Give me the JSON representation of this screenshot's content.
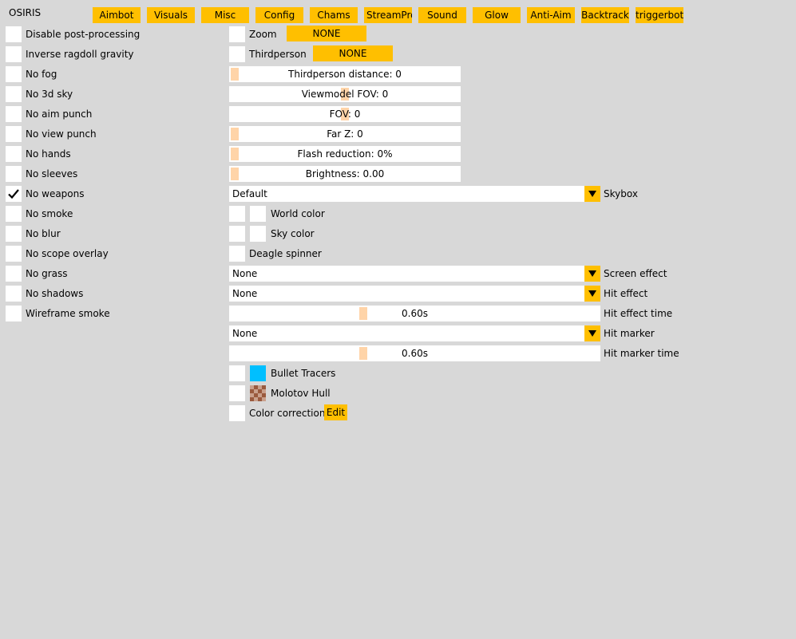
{
  "app": {
    "title": "OSIRIS"
  },
  "tabs": [
    "Aimbot",
    "Visuals",
    "Misc",
    "Config",
    "Chams",
    "StreamProof",
    "Sound",
    "Glow",
    "Anti-Aim",
    "Backtrack",
    "triggerbot"
  ],
  "left": [
    {
      "label": "Disable post-processing",
      "checked": false
    },
    {
      "label": "Inverse ragdoll gravity",
      "checked": false
    },
    {
      "label": "No fog",
      "checked": false
    },
    {
      "label": "No 3d sky",
      "checked": false
    },
    {
      "label": "No aim punch",
      "checked": false
    },
    {
      "label": "No view punch",
      "checked": false
    },
    {
      "label": "No hands",
      "checked": false
    },
    {
      "label": "No sleeves",
      "checked": false
    },
    {
      "label": "No weapons",
      "checked": true
    },
    {
      "label": "No smoke",
      "checked": false
    },
    {
      "label": "No blur",
      "checked": false
    },
    {
      "label": "No scope overlay",
      "checked": false
    },
    {
      "label": "No grass",
      "checked": false
    },
    {
      "label": "No shadows",
      "checked": false
    },
    {
      "label": "Wireframe smoke",
      "checked": false
    }
  ],
  "right": {
    "zoom": {
      "label": "Zoom",
      "key": "NONE"
    },
    "thirdperson": {
      "label": "Thirdperson",
      "key": "NONE"
    },
    "sliders": {
      "thirdperson_distance": "Thirdperson distance: 0",
      "viewmodel_fov": "Viewmodel FOV: 0",
      "fov": "FOV: 0",
      "far_z": "Far Z: 0",
      "flash_reduction": "Flash reduction: 0%",
      "brightness": "Brightness: 0.00"
    },
    "skybox": {
      "value": "Default",
      "label": "Skybox"
    },
    "world_color": "World color",
    "sky_color": "Sky color",
    "deagle_spinner": "Deagle spinner",
    "screen_effect": {
      "value": "None",
      "label": "Screen effect"
    },
    "hit_effect": {
      "value": "None",
      "label": "Hit effect"
    },
    "hit_effect_time": {
      "value": "0.60s",
      "label": "Hit effect time"
    },
    "hit_marker": {
      "value": "None",
      "label": "Hit marker"
    },
    "hit_marker_time": {
      "value": "0.60s",
      "label": "Hit marker time"
    },
    "bullet_tracers": {
      "label": "Bullet Tracers",
      "color": "#00bfff"
    },
    "molotov_hull": {
      "label": "Molotov Hull"
    },
    "color_correction": {
      "label": "Color correction",
      "button": "Edit"
    }
  },
  "colors": {
    "accent": "#ffbf00",
    "background": "#d8d8d8",
    "grab": "#ffd4a8"
  }
}
